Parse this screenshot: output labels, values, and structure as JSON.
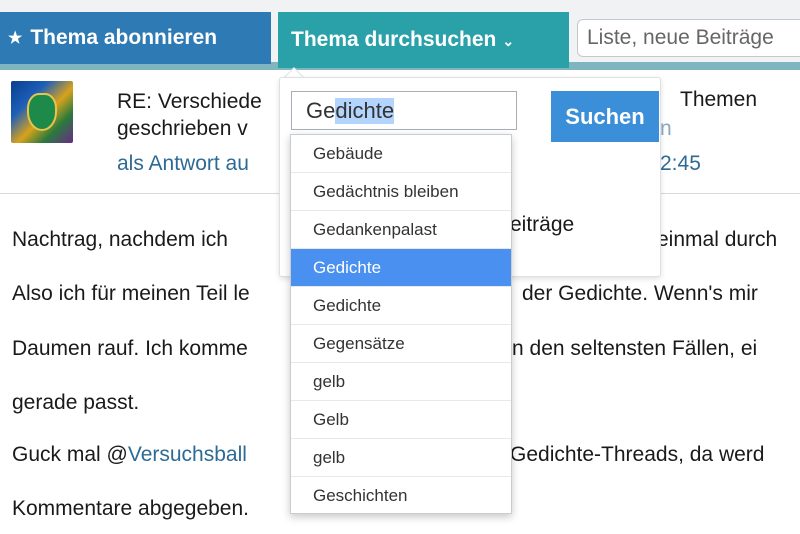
{
  "toolbar": {
    "subscribe_label": "Thema abonnieren",
    "search_label": "Thema durchsuchen",
    "quick_input_value": "Liste, neue Beiträge"
  },
  "post": {
    "title_line1": "RE: Verschiede",
    "title_line1_end": "Themen",
    "title_line2": "geschrieben v",
    "muted_end": "n",
    "reply_text": "als Antwort au",
    "time_end": "2:45"
  },
  "popup": {
    "query_prefix": "Ge",
    "query_selected": "dichte",
    "search_button": "Suchen",
    "fragment_text": "eiträge"
  },
  "suggestions": [
    "Gebäude",
    "Gedächtnis bleiben",
    "Gedankenpalast",
    "Gedichte",
    "Gedichte",
    "Gegensätze",
    "gelb",
    "Gelb",
    "gelb",
    "Geschichten"
  ],
  "body": {
    "line1_a": "Nachtrag, nachdem ich",
    "line1_b": "einmal durch",
    "line2_a": "Also ich für meinen Teil le",
    "line2_b": "der Gedichte. Wenn's mir",
    "line3_a": "Daumen rauf. Ich komme",
    "line3_b": "n den seltensten Fällen, ei",
    "line4": "gerade passt.",
    "line5_prefix": "Guck mal @",
    "line5_mention": "Versuchsball",
    "line5_b": "Gedichte-Threads, da werd",
    "line6": "Kommentare abgegeben."
  },
  "colors": {
    "subscribe_bg": "#2e7ab5",
    "search_bg": "#2aa1a8",
    "search_button_bg": "#3a8fd8",
    "active_suggestion_bg": "#4a90f0",
    "link": "#2d6b95"
  }
}
